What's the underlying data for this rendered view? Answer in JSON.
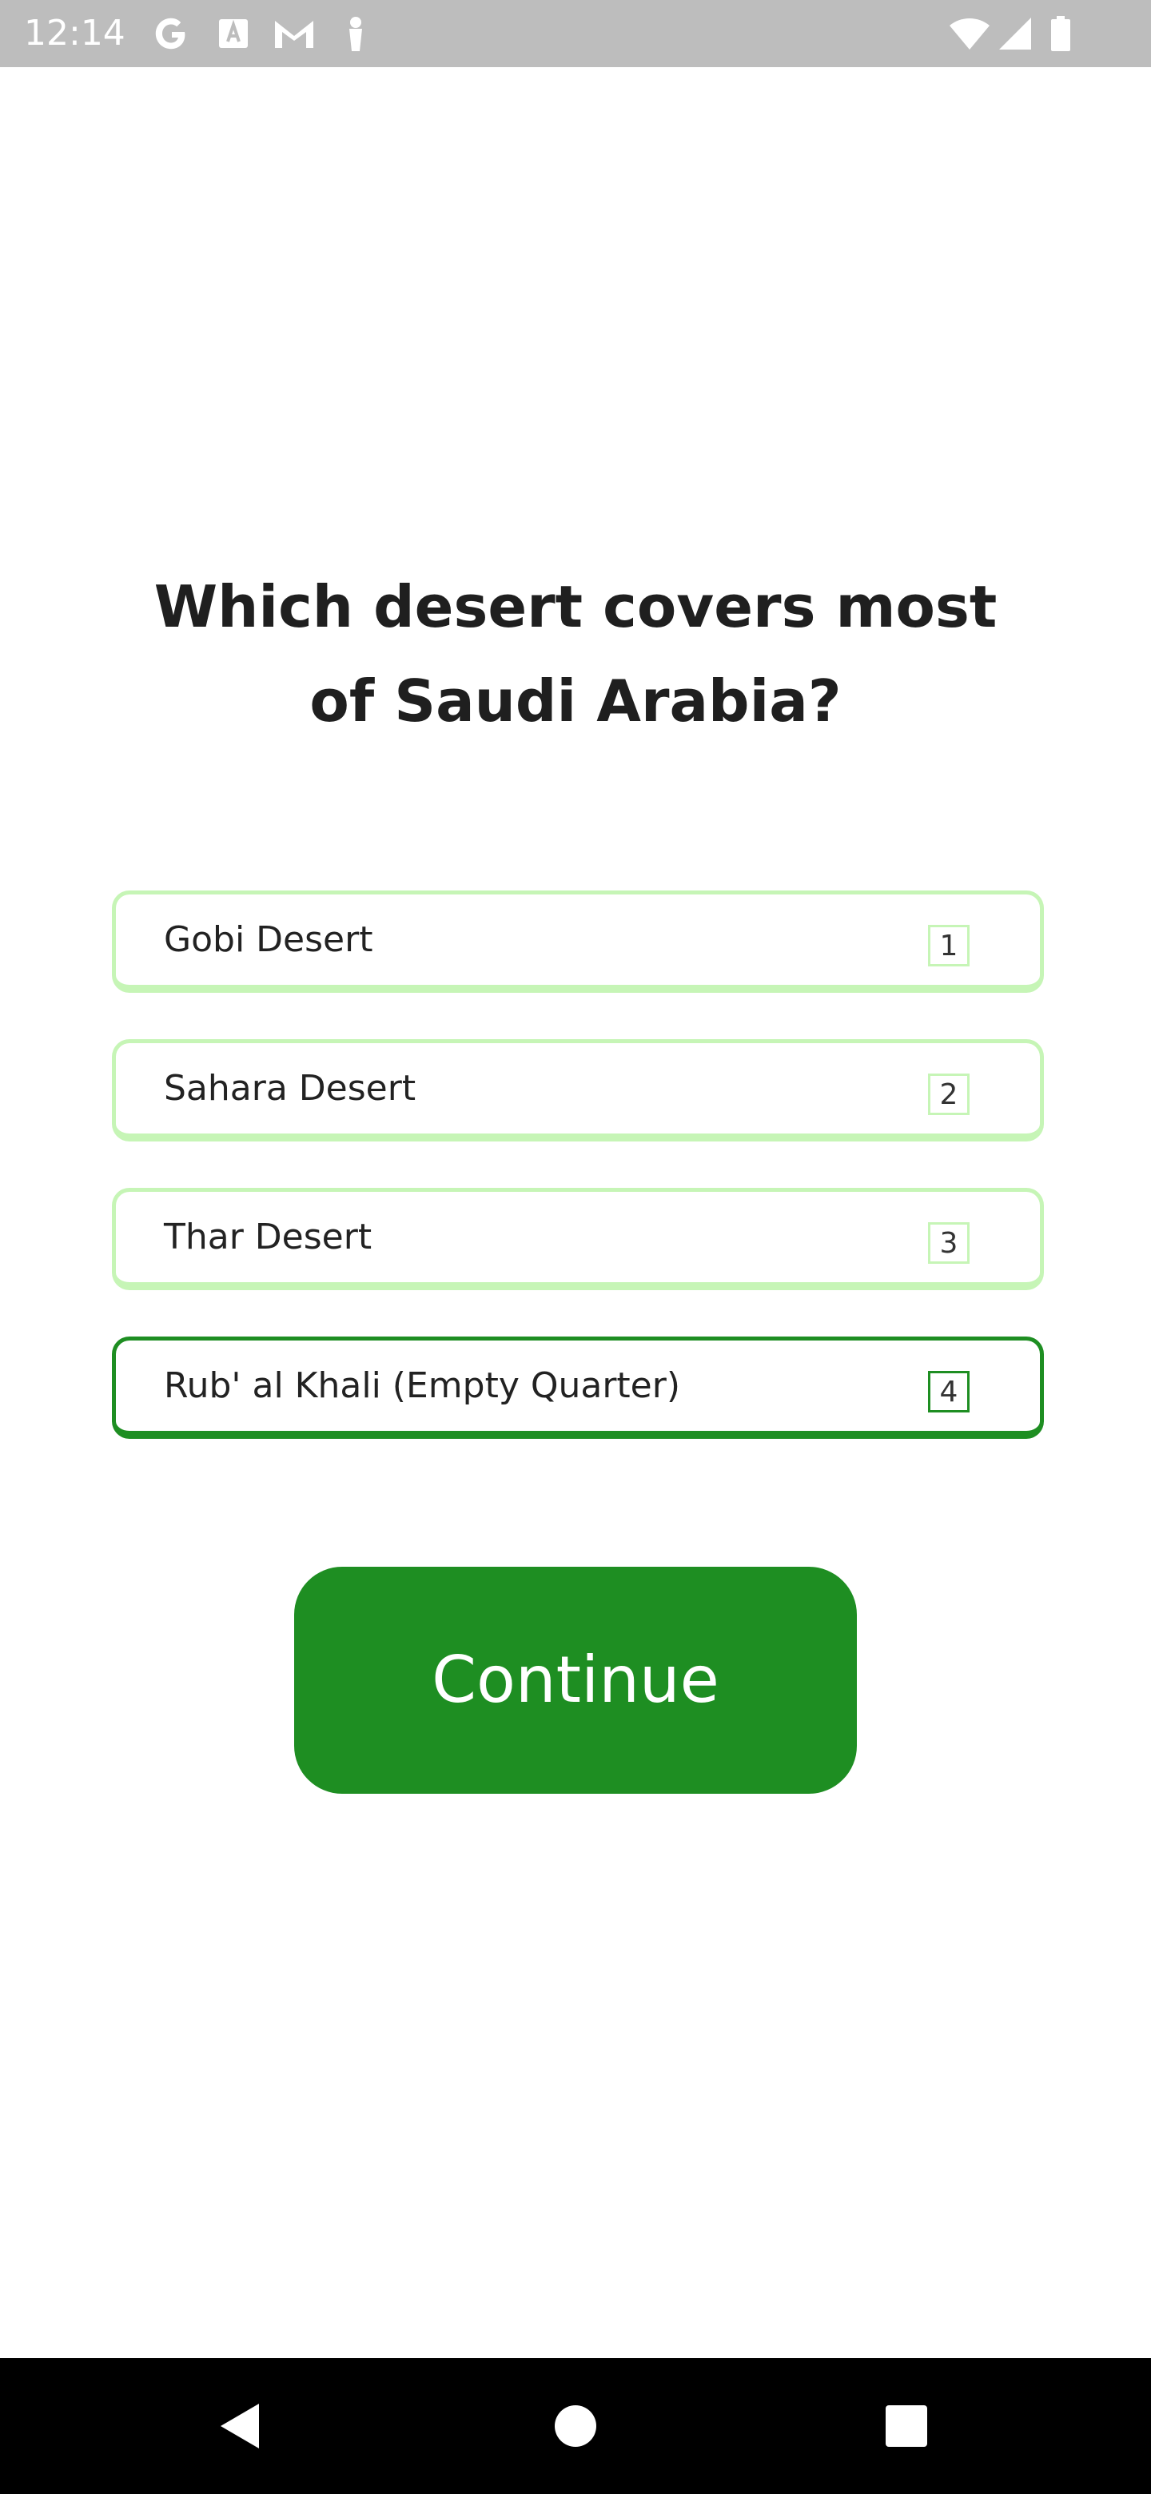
{
  "status_bar": {
    "time": "12:14",
    "left_icons": [
      "google-icon",
      "text-a-icon",
      "gmail-icon",
      "cloud-usb-icon"
    ],
    "right_icons": [
      "wifi-icon",
      "signal-icon",
      "battery-icon"
    ]
  },
  "question": {
    "text": "Which desert covers most of Saudi Arabia?"
  },
  "options": [
    {
      "label": "Gobi Desert",
      "key": "1",
      "selected": false
    },
    {
      "label": "Sahara Desert",
      "key": "2",
      "selected": false
    },
    {
      "label": "Thar Desert",
      "key": "3",
      "selected": false
    },
    {
      "label": "Rub' al Khali (Empty Quarter)",
      "key": "4",
      "selected": true
    }
  ],
  "continue_button": {
    "label": "Continue"
  },
  "nav_bar": {
    "icons": [
      "back-icon",
      "home-icon",
      "recents-icon"
    ]
  },
  "colors": {
    "accent_green": "#1e8e22",
    "option_border": "#c6f5b6",
    "status_bar": "#bdbdbd",
    "nav_bar": "#000000"
  }
}
